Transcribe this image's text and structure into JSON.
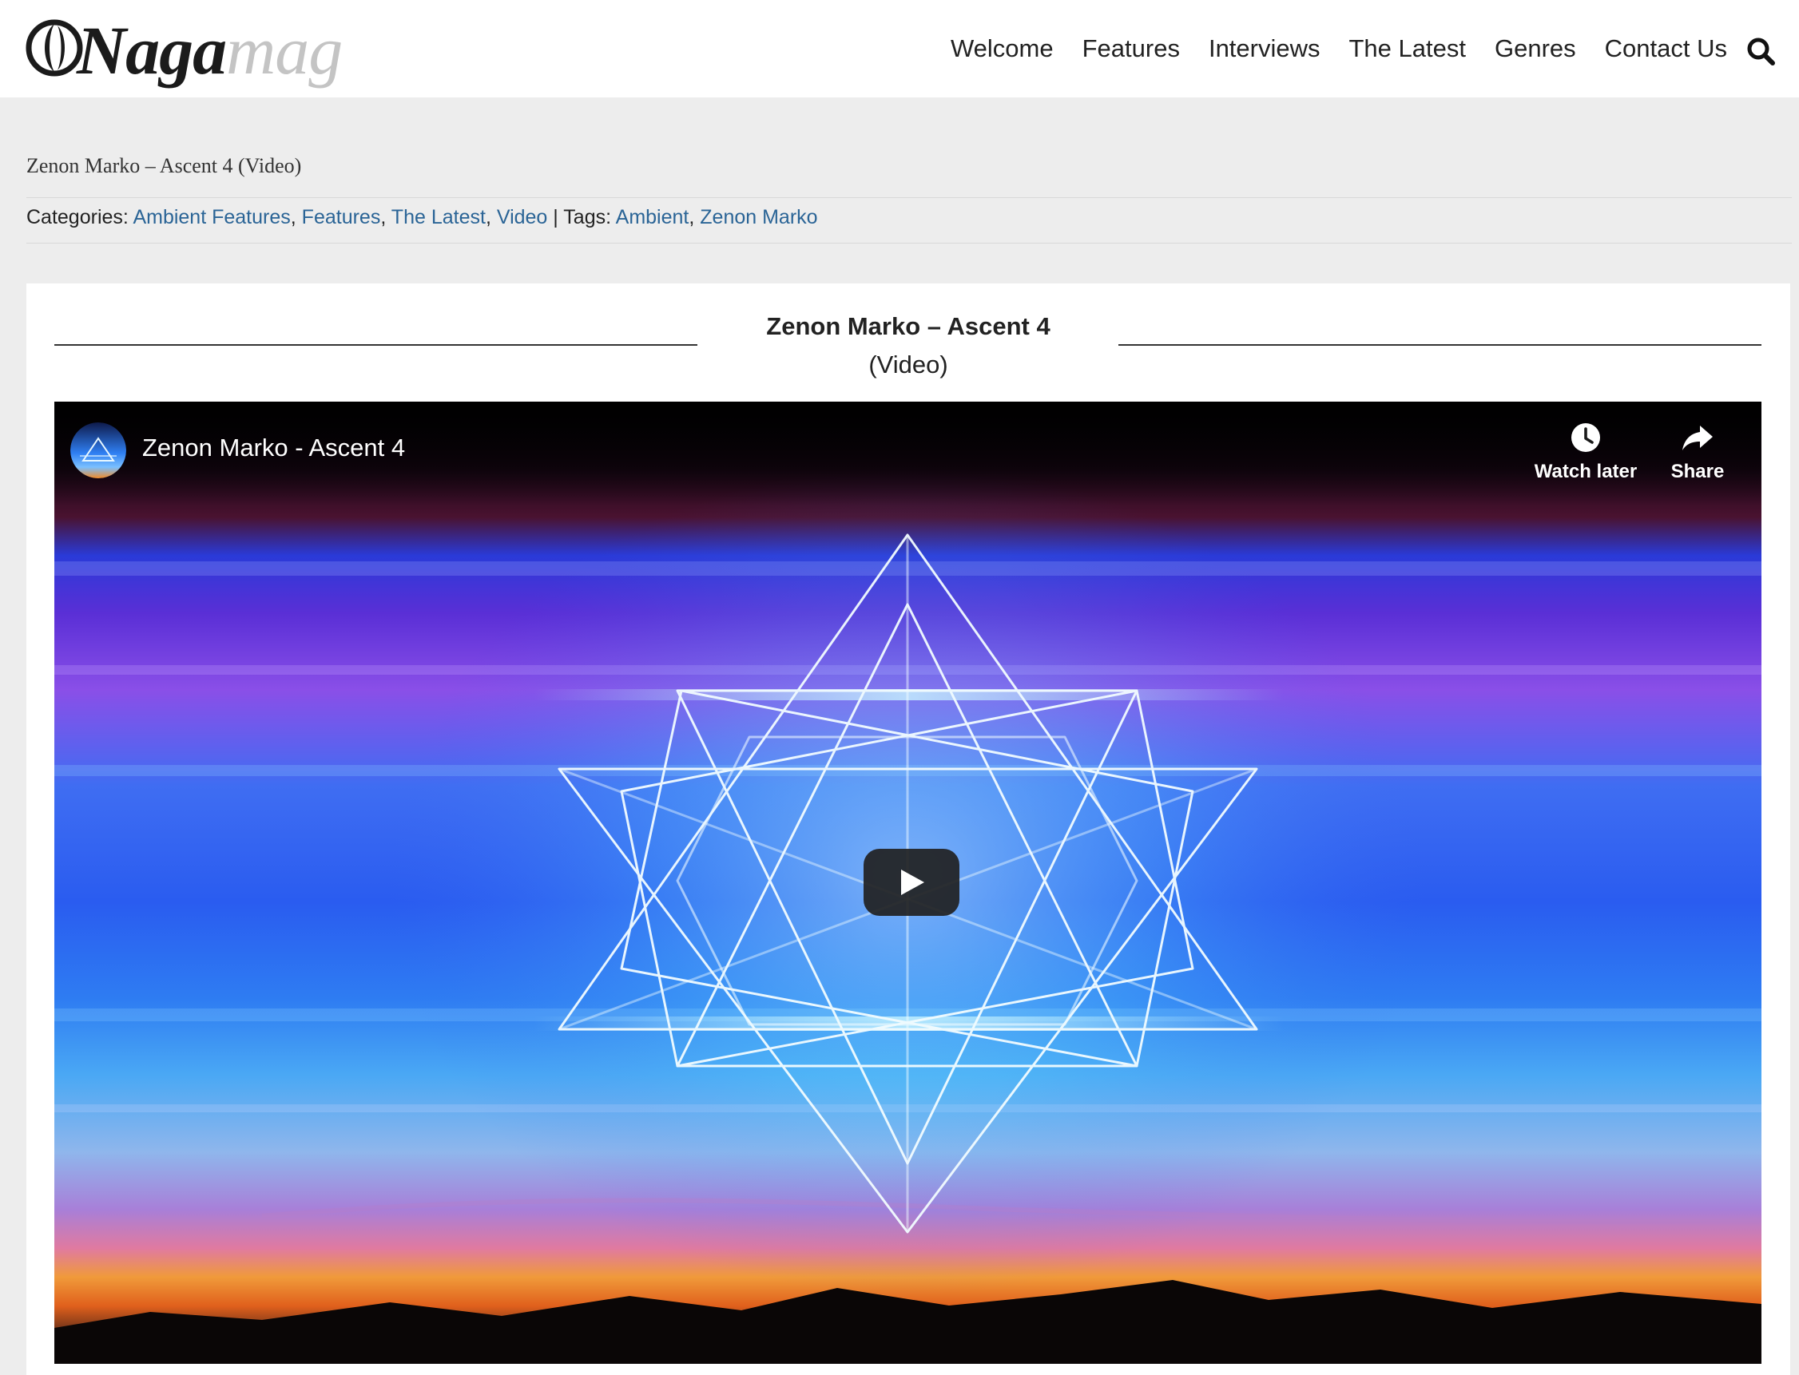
{
  "brand": {
    "logo_text_primary": "Naga",
    "logo_text_secondary": "mag"
  },
  "nav": {
    "items": [
      "Welcome",
      "Features",
      "Interviews",
      "The Latest",
      "Genres",
      "Contact Us"
    ],
    "search_icon": "search-icon"
  },
  "breadcrumb": "Zenon Marko – Ascent 4 (Video)",
  "meta": {
    "categories_label": "Categories:",
    "categories": [
      "Ambient Features",
      "Features",
      "The Latest",
      "Video"
    ],
    "divider": "|",
    "tags_label": "Tags:",
    "tags": [
      "Ambient",
      "Zenon Marko"
    ]
  },
  "post": {
    "title": "Zenon Marko – Ascent 4",
    "subtitle": "(Video)"
  },
  "video": {
    "title": "Zenon Marko - Ascent 4",
    "watch_later_label": "Watch later",
    "share_label": "Share",
    "icons": [
      "clock-icon",
      "share-icon",
      "play-icon"
    ]
  },
  "colors": {
    "link": "#2a6496",
    "page_bg": "#ededed",
    "header_bg": "#ffffff",
    "play_button": "#212121"
  }
}
